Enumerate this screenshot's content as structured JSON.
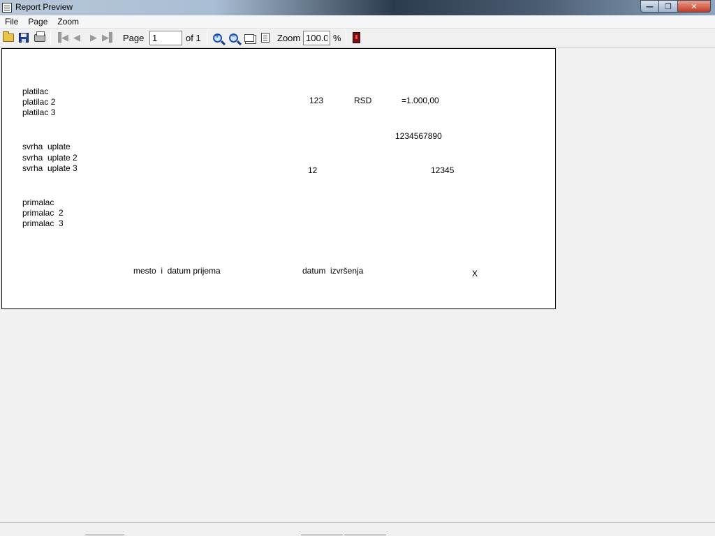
{
  "window": {
    "title": "Report Preview",
    "buttons": {
      "minimize": "—",
      "maximize": "❐",
      "close": "✕"
    }
  },
  "menu": {
    "items": [
      "File",
      "Page",
      "Zoom"
    ]
  },
  "toolbar": {
    "open_icon": "folder-open-icon",
    "save_icon": "save-icon",
    "print_icon": "printer-icon",
    "first_icon": "▐◀",
    "prev_icon": "◀",
    "next_icon": "▶",
    "last_icon": "▶▌",
    "page_label": "Page",
    "page_value": "1",
    "of_label": "of 1",
    "zoom_in_sign": "+",
    "zoom_out_sign": "−",
    "zoom_label": "Zoom",
    "zoom_value": "100.0",
    "percent_label": "%",
    "exit_icon": "exit-icon"
  },
  "report": {
    "payer": [
      "platilac",
      "platilac 2",
      "platilac 3"
    ],
    "purpose": [
      "svrha  uplate",
      "svrha  uplate 2",
      "svrha  uplate 3"
    ],
    "recipient": [
      "primalac",
      "primalac  2",
      "primalac  3"
    ],
    "code": "123",
    "currency": "RSD",
    "amount": "=1.000,00",
    "account": "1234567890",
    "model": "12",
    "reference": "12345",
    "place_date_label": "mesto  i  datum prijema",
    "execution_date_label": "datum  izvršenja",
    "mark": "X"
  }
}
